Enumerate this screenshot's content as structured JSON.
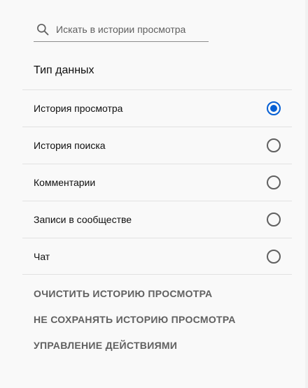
{
  "search": {
    "placeholder": "Искать в истории просмотра",
    "icon": "search-icon"
  },
  "data_type": {
    "title": "Тип данных",
    "options": [
      {
        "label": "История просмотра",
        "selected": true
      },
      {
        "label": "История поиска",
        "selected": false
      },
      {
        "label": "Комментарии",
        "selected": false
      },
      {
        "label": "Записи в сообществе",
        "selected": false
      },
      {
        "label": "Чат",
        "selected": false
      }
    ]
  },
  "actions": {
    "clear": "ОЧИСТИТЬ ИСТОРИЮ ПРОСМОТРА",
    "pause": "НЕ СОХРАНЯТЬ ИСТОРИЮ ПРОСМОТРА",
    "manage": "УПРАВЛЕНИЕ ДЕЙСТВИЯМИ"
  },
  "colors": {
    "accent": "#065fd4",
    "background": "#f9f9f9"
  }
}
